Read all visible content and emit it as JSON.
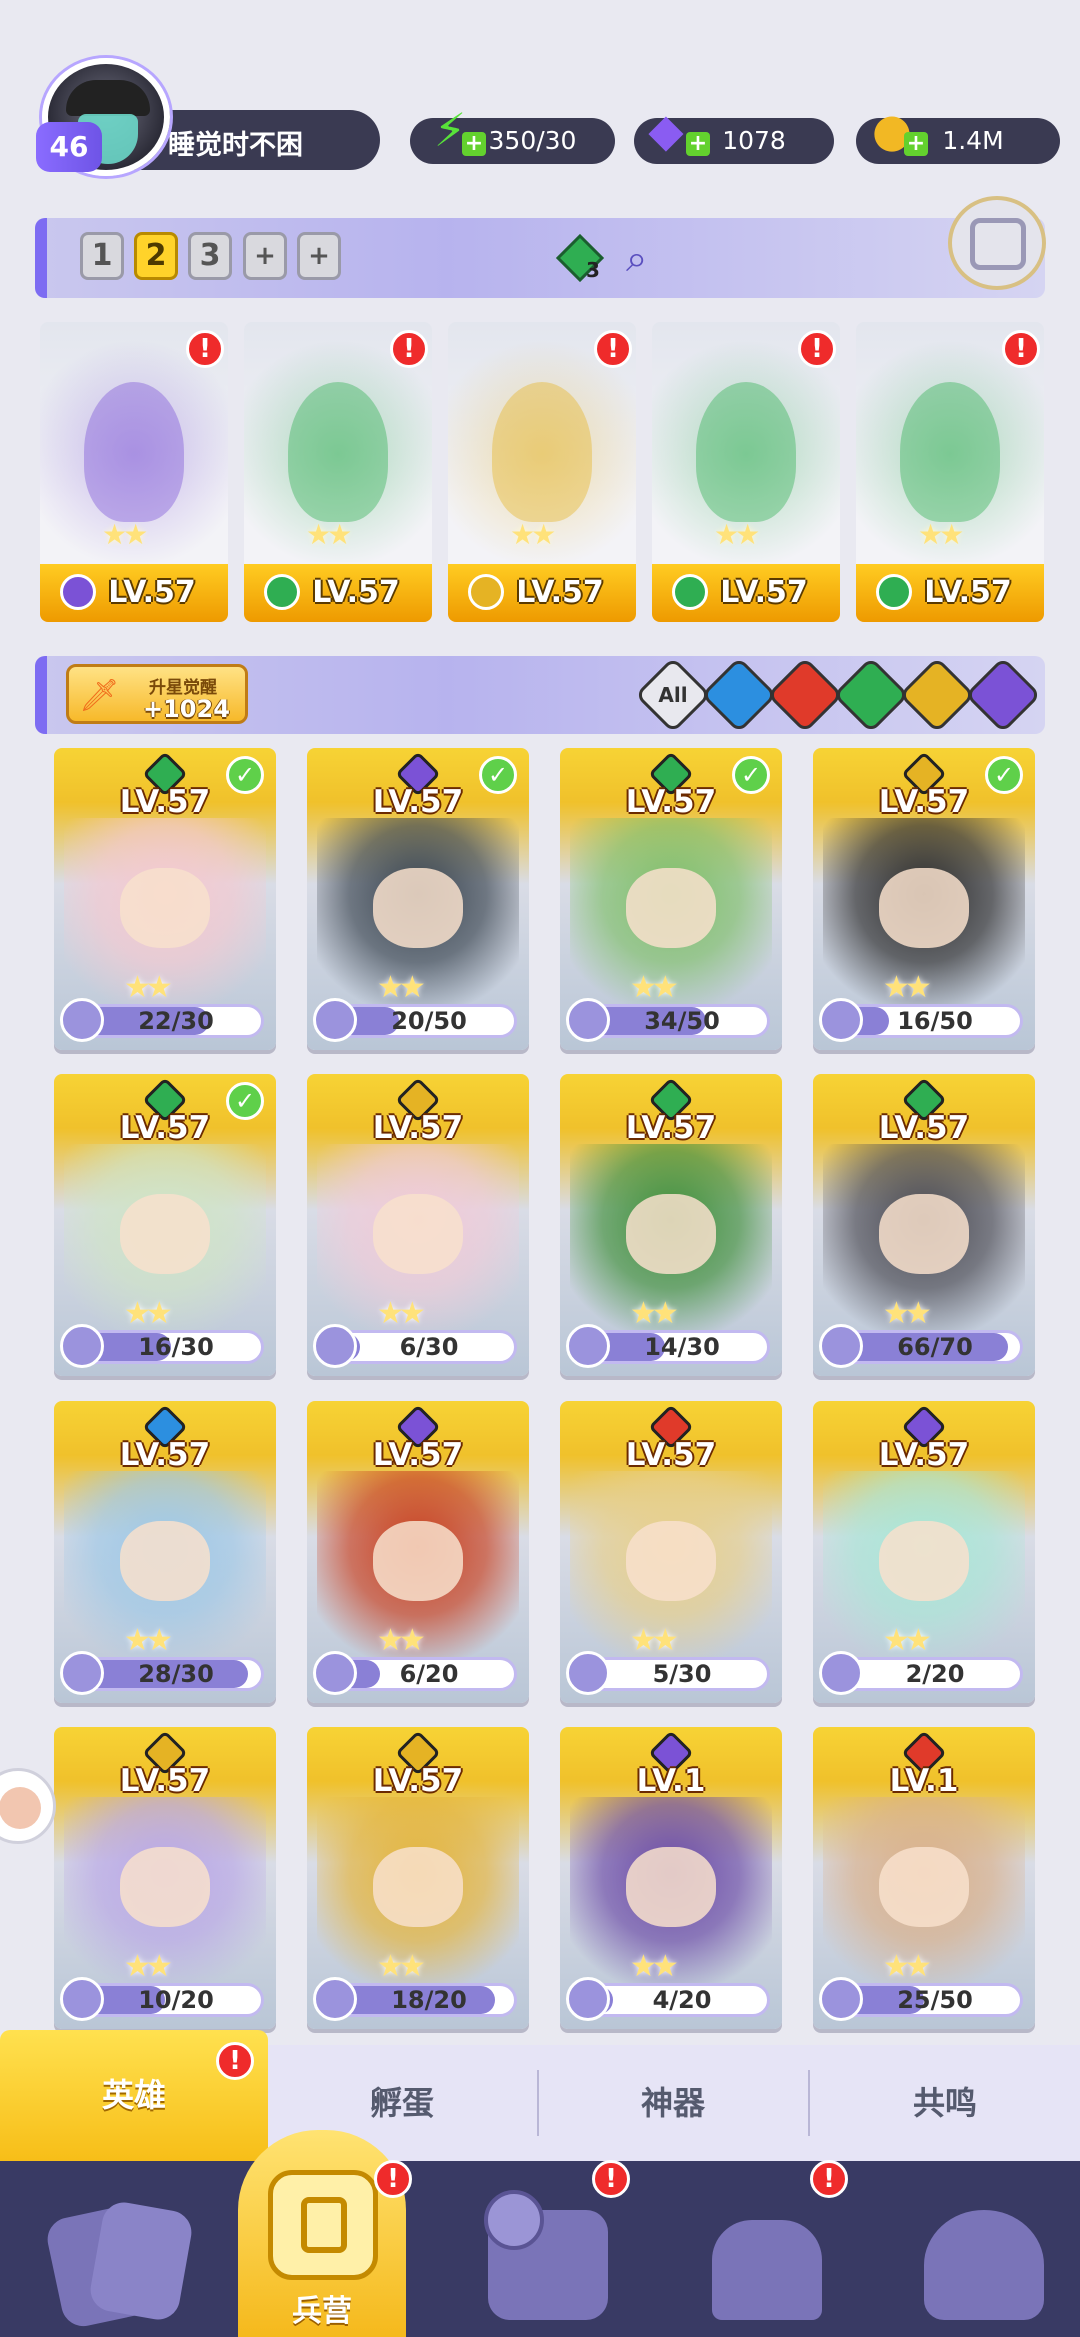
{
  "player": {
    "level": "46",
    "name": "睡觉时不困"
  },
  "resources": {
    "energy": "350/30",
    "gems": "1078",
    "gold": "1.4M"
  },
  "team_tabs": [
    "1",
    "2",
    "3",
    "+",
    "+"
  ],
  "active_team_tab": "2",
  "team_gem_count": "3",
  "team_slots": [
    {
      "level": "LV.57",
      "element": "moon",
      "color": "#7b52d6"
    },
    {
      "level": "LV.57",
      "element": "leaf",
      "color": "#2fae52"
    },
    {
      "level": "LV.57",
      "element": "light",
      "color": "#e5b324"
    },
    {
      "level": "LV.57",
      "element": "leaf",
      "color": "#2fae52"
    },
    {
      "level": "LV.57",
      "element": "leaf",
      "color": "#2fae52"
    }
  ],
  "awaken": {
    "title": "升星觉醒",
    "value": "+1024"
  },
  "filters": [
    {
      "label": "All",
      "color": "#e8e8ee",
      "text_color": "#333"
    },
    {
      "label": "",
      "color": "#2c8fe0",
      "icon": "water-icon"
    },
    {
      "label": "",
      "color": "#e03a2a",
      "icon": "fire-icon"
    },
    {
      "label": "",
      "color": "#2fae52",
      "icon": "leaf-icon"
    },
    {
      "label": "",
      "color": "#e5b324",
      "icon": "light-icon"
    },
    {
      "label": "",
      "color": "#7b52d6",
      "icon": "moon-icon"
    }
  ],
  "heroes": [
    {
      "level": "LV.57",
      "fragments": "22/30",
      "progress": 0.73,
      "element_color": "#2fae52",
      "checked": true,
      "art": "#f4c9d0"
    },
    {
      "level": "LV.57",
      "fragments": "20/50",
      "progress": 0.4,
      "element_color": "#7b52d6",
      "checked": true,
      "art": "#3a4550"
    },
    {
      "level": "LV.57",
      "fragments": "34/50",
      "progress": 0.68,
      "element_color": "#2fae52",
      "checked": true,
      "art": "#7fbf6a"
    },
    {
      "level": "LV.57",
      "fragments": "16/50",
      "progress": 0.32,
      "element_color": "#e5b324",
      "checked": true,
      "art": "#2c2c2c"
    },
    {
      "level": "LV.57",
      "fragments": "16/30",
      "progress": 0.53,
      "element_color": "#2fae52",
      "checked": true,
      "art": "#cfe4c6"
    },
    {
      "level": "LV.57",
      "fragments": "6/30",
      "progress": 0.2,
      "element_color": "#e5b324",
      "checked": false,
      "art": "#f0cbd8"
    },
    {
      "level": "LV.57",
      "fragments": "14/30",
      "progress": 0.47,
      "element_color": "#2fae52",
      "checked": false,
      "art": "#3f8f3a"
    },
    {
      "level": "LV.57",
      "fragments": "66/70",
      "progress": 0.94,
      "element_color": "#2fae52",
      "checked": false,
      "art": "#4a4a52"
    },
    {
      "level": "LV.57",
      "fragments": "28/30",
      "progress": 0.93,
      "element_color": "#2c8fe0",
      "checked": false,
      "art": "#9ec8e6"
    },
    {
      "level": "LV.57",
      "fragments": "6/20",
      "progress": 0.3,
      "element_color": "#7b52d6",
      "checked": false,
      "art": "#c8401f"
    },
    {
      "level": "LV.57",
      "fragments": "5/30",
      "progress": 0.17,
      "element_color": "#e03a2a",
      "checked": false,
      "art": "#e7cf8a"
    },
    {
      "level": "LV.57",
      "fragments": "2/20",
      "progress": 0.1,
      "element_color": "#7b52d6",
      "checked": false,
      "art": "#a9e6d6"
    },
    {
      "level": "LV.57",
      "fragments": "10/20",
      "progress": 0.5,
      "element_color": "#e5b324",
      "checked": false,
      "art": "#b9a7e6"
    },
    {
      "level": "LV.57",
      "fragments": "18/20",
      "progress": 0.9,
      "element_color": "#e5b324",
      "checked": false,
      "art": "#e4b43a"
    },
    {
      "level": "LV.1",
      "fragments": "4/20",
      "progress": 0.2,
      "element_color": "#7b52d6",
      "checked": false,
      "art": "#6a4aa6"
    },
    {
      "level": "LV.1",
      "fragments": "25/50",
      "progress": 0.5,
      "element_color": "#e03a2a",
      "checked": false,
      "art": "#d9b08a"
    }
  ],
  "sub_tabs": [
    "英雄",
    "孵蛋",
    "神器",
    "共鸣"
  ],
  "nav": {
    "active_label": "兵营"
  }
}
